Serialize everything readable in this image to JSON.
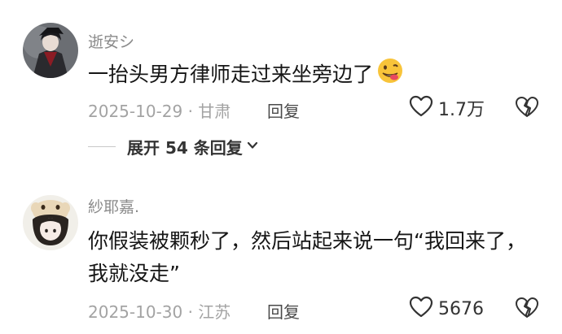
{
  "comments": [
    {
      "username": "逝安シ",
      "text": "一抬头男方律师走过来坐旁边了",
      "emoji": "grimace-face-emoji",
      "date_location": "2025-10-29 · 甘肃",
      "reply_label": "回复",
      "likes": "1.7万",
      "expand_label": "展开 54 条回复"
    },
    {
      "username": "紗耶嘉.",
      "text": "你假装被颗秒了，然后站起来说一句“我回来了，我就没走”",
      "date_location": "2025-10-30 · 江苏",
      "reply_label": "回复",
      "likes": "5676"
    }
  ],
  "icons": {
    "like": "heart-outline-icon",
    "dislike": "broken-heart-icon",
    "expand": "chevron-down-icon"
  },
  "colors": {
    "text": "#161616",
    "meta": "#a3a3a3",
    "username": "#8a8a8a"
  }
}
